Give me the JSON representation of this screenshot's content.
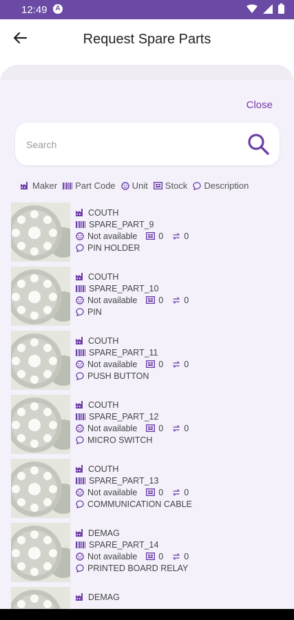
{
  "status": {
    "time": "12:49",
    "app_badge": "A"
  },
  "header": {
    "title": "Request Spare Parts"
  },
  "panel": {
    "close_label": "Close",
    "search_placeholder": "Search",
    "legend": {
      "maker": "Maker",
      "part_code": "Part Code",
      "unit": "Unit",
      "stock": "Stock",
      "description": "Description"
    }
  },
  "parts": [
    {
      "maker": "COUTH",
      "code": "SPARE_PART_9",
      "unit": "Not available",
      "stock": "0",
      "sync": "0",
      "description": "PIN HOLDER"
    },
    {
      "maker": "COUTH",
      "code": "SPARE_PART_10",
      "unit": "Not available",
      "stock": "0",
      "sync": "0",
      "description": "PIN"
    },
    {
      "maker": "COUTH",
      "code": "SPARE_PART_11",
      "unit": "Not available",
      "stock": "0",
      "sync": "0",
      "description": "PUSH BUTTON"
    },
    {
      "maker": "COUTH",
      "code": "SPARE_PART_12",
      "unit": "Not available",
      "stock": "0",
      "sync": "0",
      "description": "MICRO SWITCH"
    },
    {
      "maker": "COUTH",
      "code": "SPARE_PART_13",
      "unit": "Not available",
      "stock": "0",
      "sync": "0",
      "description": "COMMUNICATION CABLE"
    },
    {
      "maker": "DEMAG",
      "code": "SPARE_PART_14",
      "unit": "Not available",
      "stock": "0",
      "sync": "0",
      "description": "PRINTED BOARD RELAY"
    },
    {
      "maker": "DEMAG",
      "code": "",
      "unit": "",
      "stock": "",
      "sync": "",
      "description": ""
    }
  ],
  "colors": {
    "accent": "#6b3ea6",
    "statusbar": "#6a4aa4",
    "panel_bg": "#f4f1fb"
  }
}
